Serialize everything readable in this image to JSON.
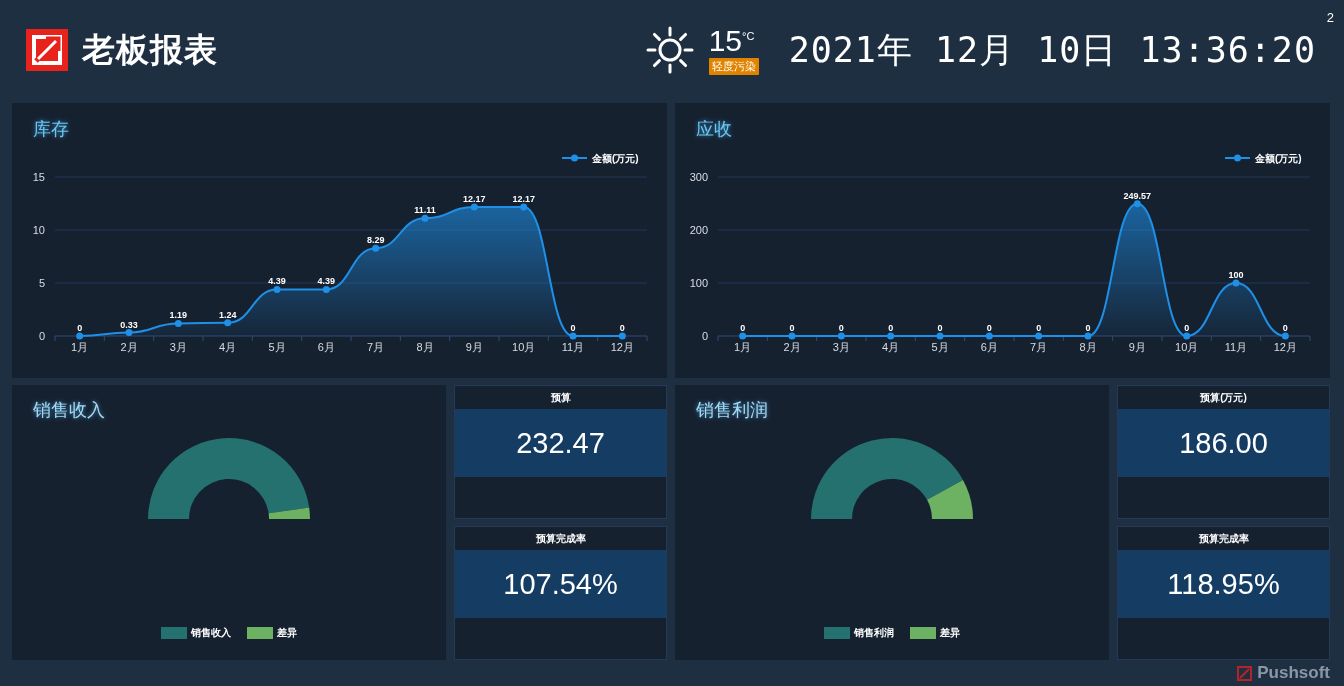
{
  "header": {
    "title": "老板报表",
    "weather": {
      "temperature": "15",
      "unit": "°C",
      "air_quality": "轻度污染"
    },
    "datetime": "2021年 12月 10日 13:36:20",
    "page_number": "2"
  },
  "charts": [
    {
      "title": "库存",
      "chart_data": {
        "type": "area",
        "categories": [
          "1月",
          "2月",
          "3月",
          "4月",
          "5月",
          "6月",
          "7月",
          "8月",
          "9月",
          "10月",
          "11月",
          "12月"
        ],
        "series": [
          {
            "name": "金额(万元)",
            "color": "#1e90e8",
            "values": [
              0,
              0.33,
              1.19,
              1.24,
              4.39,
              4.39,
              8.29,
              11.11,
              12.17,
              12.17,
              0,
              0
            ]
          }
        ],
        "ylim": [
          0,
          15
        ],
        "yticks": [
          0,
          5,
          10,
          15
        ],
        "data_labels": true
      }
    },
    {
      "title": "应收",
      "chart_data": {
        "type": "area",
        "categories": [
          "1月",
          "2月",
          "3月",
          "4月",
          "5月",
          "6月",
          "7月",
          "8月",
          "9月",
          "10月",
          "11月",
          "12月"
        ],
        "series": [
          {
            "name": "金额(万元)",
            "color": "#1e90e8",
            "values": [
              0,
              0,
              0,
              0,
              0,
              0,
              0,
              0,
              249.57,
              0,
              100,
              0
            ]
          }
        ],
        "ylim": [
          0,
          300
        ],
        "yticks": [
          0,
          100,
          200,
          300
        ],
        "data_labels": true
      }
    }
  ],
  "gauges": [
    {
      "title": "销售收入",
      "legend": [
        {
          "label": "销售收入",
          "color": "#25716f"
        },
        {
          "label": "差异",
          "color": "#6db163"
        }
      ],
      "cards": [
        {
          "label": "预算",
          "value": "232.47"
        },
        {
          "label": "预算完成率",
          "value": "107.54%"
        }
      ]
    },
    {
      "title": "销售利润",
      "legend": [
        {
          "label": "销售利润",
          "color": "#25716f"
        },
        {
          "label": "差异",
          "color": "#6db163"
        }
      ],
      "cards": [
        {
          "label": "预算(万元)",
          "value": "186.00"
        },
        {
          "label": "预算完成率",
          "value": "118.95%"
        }
      ]
    }
  ],
  "footer": {
    "brand": "Pushsoft"
  }
}
